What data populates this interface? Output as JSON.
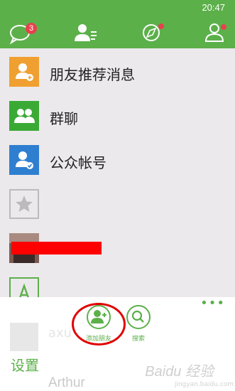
{
  "status": {
    "time": "20:47"
  },
  "tabs": [
    {
      "name": "chats",
      "icon": "chat-bubble-icon",
      "badge": "3"
    },
    {
      "name": "contacts",
      "icon": "contacts-list-icon",
      "selected": true
    },
    {
      "name": "discover",
      "icon": "compass-icon",
      "dot": true
    },
    {
      "name": "me",
      "icon": "person-icon",
      "dot": true
    }
  ],
  "list": {
    "items": [
      {
        "label": "朋友推荐消息",
        "icon": "friend-recommend-icon",
        "color": "#f0a030"
      },
      {
        "label": "群聊",
        "icon": "group-chat-icon",
        "color": "#3aaa35"
      },
      {
        "label": "公众帐号",
        "icon": "official-account-icon",
        "color": "#2f7fd0"
      },
      {
        "label": "",
        "icon": "star-icon",
        "color": "#bbbbbb"
      },
      {
        "label": "",
        "icon": "contact-photo",
        "redacted": true
      },
      {
        "label": "",
        "icon": "letter-a-icon",
        "color": "#5cb04a"
      }
    ]
  },
  "appbar": {
    "add_friend_label": "添加朋友",
    "search_label": "搜索",
    "settings_label": "设置",
    "faded_contact": "Arthur",
    "faded_letters": "axu",
    "watermark": "Baidu 经验",
    "watermark_sub": "jingyan.baidu.com"
  },
  "colors": {
    "accent": "#5cb04a",
    "badge": "#e8414e"
  }
}
